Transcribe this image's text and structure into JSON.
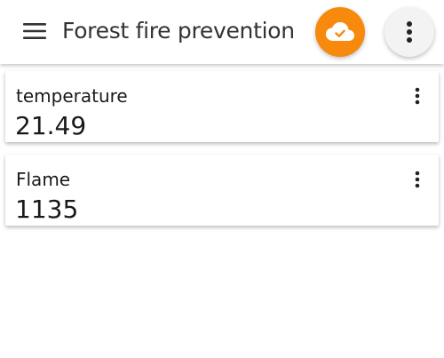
{
  "header": {
    "title": "Forest fire prevention",
    "menu_icon": "hamburger-menu-icon",
    "cloud_icon": "cloud-check-icon",
    "overflow_icon": "more-vert-icon",
    "accent_color": "#f78a0c"
  },
  "cards": [
    {
      "label": "temperature",
      "value": "21.49",
      "menu_icon": "more-vert-icon"
    },
    {
      "label": "Flame",
      "value": "1135",
      "menu_icon": "more-vert-icon"
    }
  ]
}
